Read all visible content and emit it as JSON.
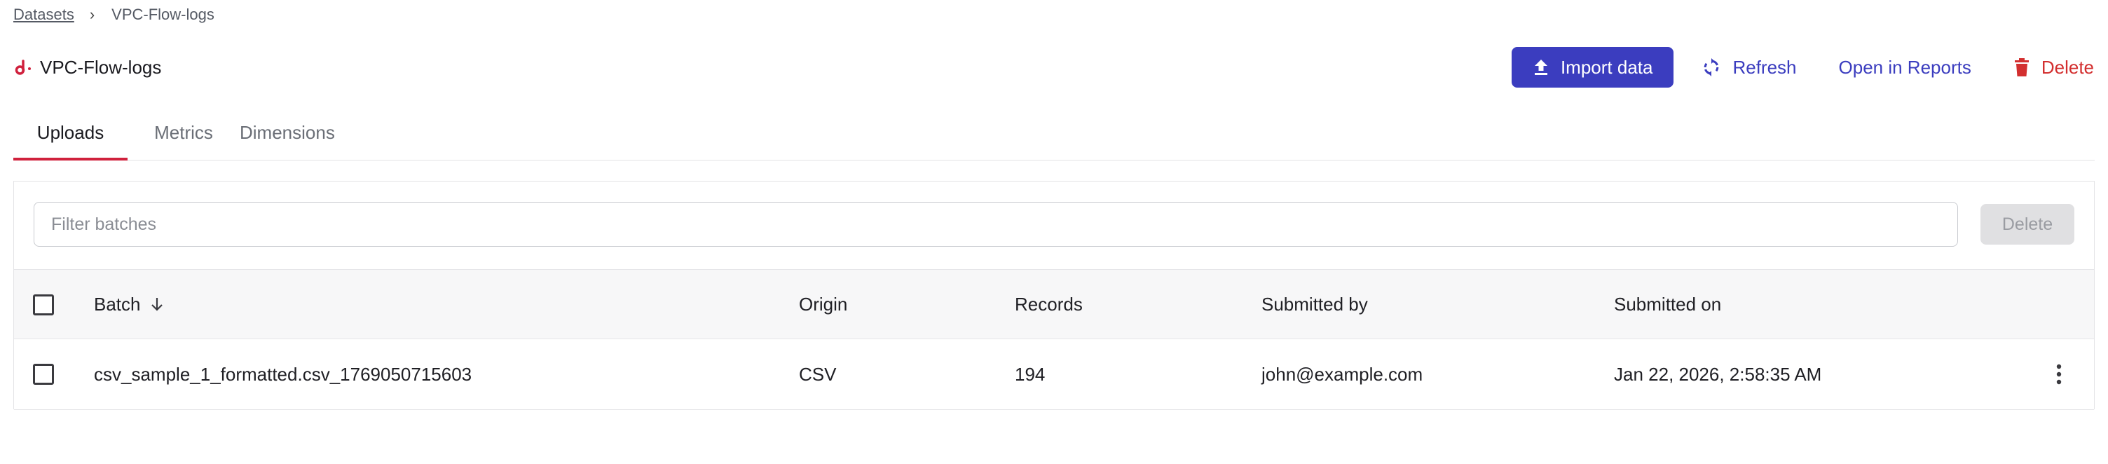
{
  "breadcrumb": {
    "root": "Datasets",
    "separator": "›",
    "current": "VPC-Flow-logs"
  },
  "header": {
    "title": "VPC-Flow-logs",
    "logo_icon": "brand-d-icon",
    "brand_color": "#d0213d",
    "actions": {
      "import": "Import data",
      "refresh": "Refresh",
      "open_reports": "Open in Reports",
      "delete": "Delete"
    },
    "colors": {
      "primary": "#3b3dbf",
      "danger": "#d32f2f"
    }
  },
  "tabs": [
    {
      "label": "Uploads",
      "active": true
    },
    {
      "label": "Metrics",
      "active": false
    },
    {
      "label": "Dimensions",
      "active": false
    }
  ],
  "filter": {
    "placeholder": "Filter batches",
    "value": "",
    "delete_label": "Delete"
  },
  "table": {
    "columns": {
      "batch": "Batch",
      "origin": "Origin",
      "records": "Records",
      "submitted_by": "Submitted by",
      "submitted_on": "Submitted on"
    },
    "sort": {
      "column": "batch",
      "direction": "descending",
      "icon": "arrow-down-icon"
    },
    "rows": [
      {
        "batch": "csv_sample_1_formatted.csv_1769050715603",
        "origin": "CSV",
        "records": "194",
        "submitted_by": "john@example.com",
        "submitted_on": "Jan 22, 2026, 2:58:35 AM",
        "checked": false
      }
    ]
  }
}
